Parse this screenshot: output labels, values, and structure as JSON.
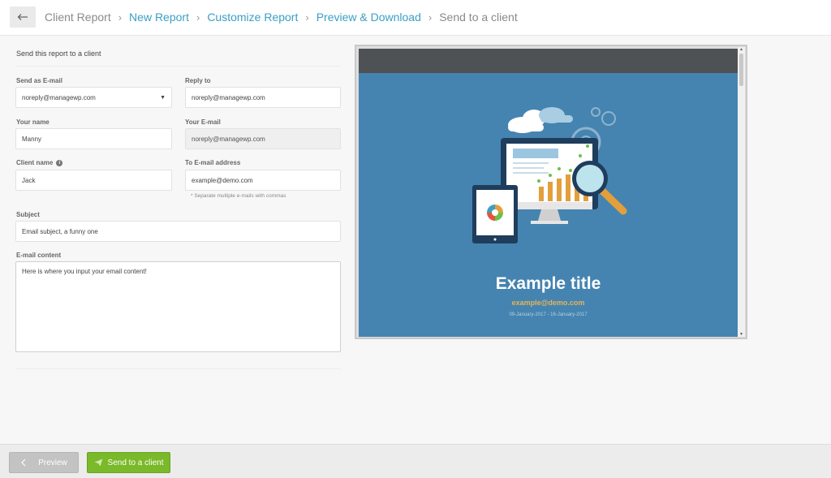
{
  "breadcrumb": {
    "items": [
      {
        "label": "Client Report",
        "link": false
      },
      {
        "label": "New Report",
        "link": true
      },
      {
        "label": "Customize Report",
        "link": true
      },
      {
        "label": "Preview & Download",
        "link": true
      },
      {
        "label": "Send to a client",
        "link": false
      }
    ],
    "back_icon": "arrow-left-icon"
  },
  "form": {
    "section_title": "Send this report to a client",
    "send_as_label": "Send as E-mail",
    "send_as_value": "noreply@managewp.com",
    "reply_to_label": "Reply to",
    "reply_to_value": "noreply@managewp.com",
    "your_name_label": "Your name",
    "your_name_value": "Manny",
    "your_email_label": "Your E-mail",
    "your_email_value": "noreply@managewp.com",
    "client_name_label": "Client name",
    "client_name_value": "Jack",
    "to_email_label": "To E-mail address",
    "to_email_value": "example@demo.com",
    "to_email_hint": "* Separate multiple e-mails with commas",
    "subject_label": "Subject",
    "subject_value": "Email subject, a funny one",
    "content_label": "E-mail content",
    "content_value": "Here is where you input your email content!"
  },
  "preview": {
    "title": "Example title",
    "email": "example@demo.com",
    "dates": "09-January-2017 - 16-January-2017",
    "colors": {
      "background": "#4584b0",
      "header": "#4f5254",
      "accent": "#e6b35a"
    }
  },
  "footer": {
    "preview_label": "Preview",
    "send_label": "Send to a client",
    "send_color": "#7ab929"
  }
}
